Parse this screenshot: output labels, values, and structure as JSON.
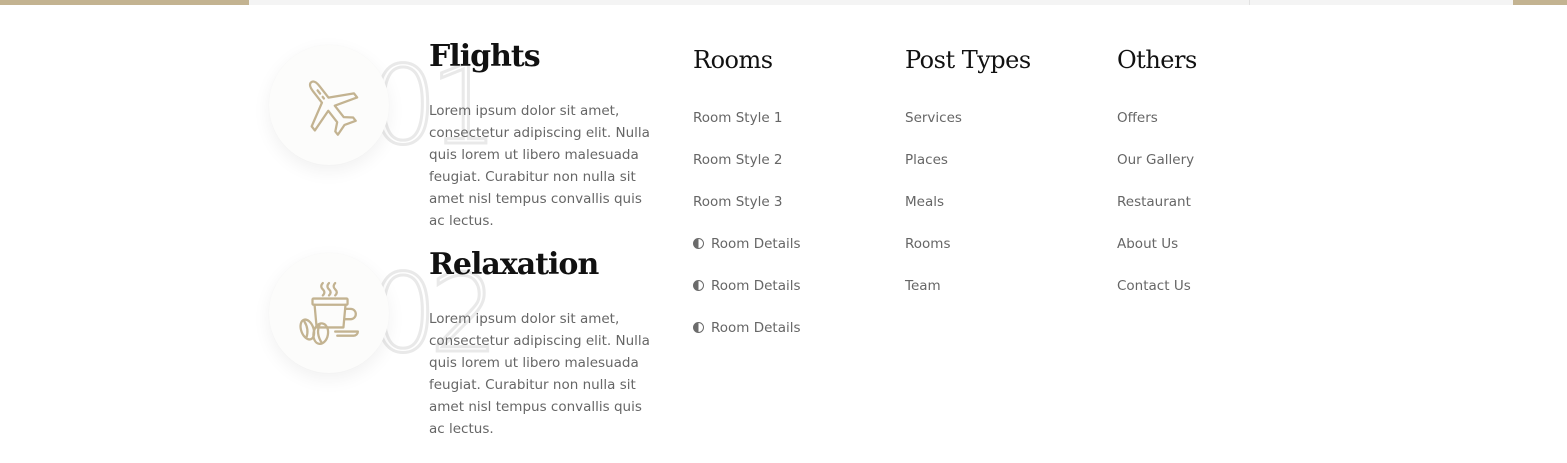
{
  "colors": {
    "accent": "#c3b391",
    "heading": "#111111",
    "text": "#666666"
  },
  "features": [
    {
      "number": "01",
      "title": "Flights",
      "icon": "airplane-icon",
      "text": "Lorem ipsum dolor sit amet, consectetur adipiscing elit. Nulla quis lorem ut libero malesuada feugiat. Curabitur non nulla sit amet nisl tempus convallis quis ac lectus."
    },
    {
      "number": "02",
      "title": "Relaxation",
      "icon": "coffee-cup-icon",
      "text": "Lorem ipsum dolor sit amet, consectetur adipiscing elit. Nulla quis lorem ut libero malesuada feugiat. Curabitur non nulla sit amet nisl tempus convallis quis ac lectus."
    }
  ],
  "columns": [
    {
      "title": "Rooms",
      "items": [
        "Room Style 1",
        "Room Style 2",
        "Room Style 3",
        "Room Details",
        "Room Details",
        "Room Details"
      ]
    },
    {
      "title": "Post Types",
      "items": [
        "Services",
        "Places",
        "Meals",
        "Rooms",
        "Team"
      ]
    },
    {
      "title": "Others",
      "items": [
        "Offers",
        "Our Gallery",
        "Restaurant",
        "About Us",
        "Contact Us"
      ]
    }
  ]
}
